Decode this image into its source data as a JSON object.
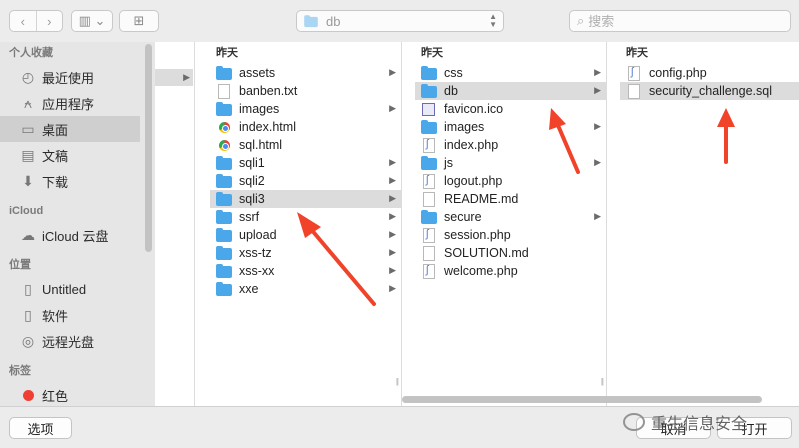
{
  "toolbar": {
    "back_glyph": "‹",
    "forward_glyph": "›",
    "view_glyph": "▥ ⌄",
    "new_folder_glyph": "⊞",
    "path_label": "db",
    "search_placeholder": "搜索"
  },
  "sidebar": {
    "sections": [
      {
        "header": "个人收藏",
        "items": [
          {
            "label": "最近使用",
            "icon": "clock-icon",
            "glyph": "◴"
          },
          {
            "label": "应用程序",
            "icon": "applications-icon",
            "glyph": "⍲"
          },
          {
            "label": "桌面",
            "icon": "desktop-icon",
            "glyph": "▭",
            "selected": true
          },
          {
            "label": "文稿",
            "icon": "documents-icon",
            "glyph": "▤"
          },
          {
            "label": "下载",
            "icon": "download-icon",
            "glyph": "⬇"
          }
        ]
      },
      {
        "header": "iCloud",
        "items": [
          {
            "label": "iCloud 云盘",
            "icon": "cloud-icon",
            "glyph": "☁"
          }
        ]
      },
      {
        "header": "位置",
        "items": [
          {
            "label": "Untitled",
            "icon": "disk-icon",
            "glyph": "▯"
          },
          {
            "label": "软件",
            "icon": "disk-icon",
            "glyph": "▯"
          },
          {
            "label": "远程光盘",
            "icon": "optical-disc-icon",
            "glyph": "◎"
          }
        ]
      },
      {
        "header": "标签",
        "items": [
          {
            "label": "红色",
            "icon": "red-tag-icon",
            "color": "#ef3f34"
          }
        ]
      }
    ]
  },
  "columns": [
    {
      "header": "昨天",
      "items": [
        {
          "name": "assets",
          "kind": "folder",
          "chevron": true
        },
        {
          "name": "banben.txt",
          "kind": "file"
        },
        {
          "name": "images",
          "kind": "folder",
          "chevron": true
        },
        {
          "name": "index.html",
          "kind": "chrome"
        },
        {
          "name": "sql.html",
          "kind": "chrome"
        },
        {
          "name": "sqli1",
          "kind": "folder",
          "chevron": true
        },
        {
          "name": "sqli2",
          "kind": "folder",
          "chevron": true
        },
        {
          "name": "sqli3",
          "kind": "folder",
          "chevron": true,
          "selected": true
        },
        {
          "name": "ssrf",
          "kind": "folder",
          "chevron": true
        },
        {
          "name": "upload",
          "kind": "folder",
          "chevron": true
        },
        {
          "name": "xss-tz",
          "kind": "folder",
          "chevron": true
        },
        {
          "name": "xss-xx",
          "kind": "folder",
          "chevron": true
        },
        {
          "name": "xxe",
          "kind": "folder",
          "chevron": true
        }
      ]
    },
    {
      "header": "昨天",
      "items": [
        {
          "name": "css",
          "kind": "folder",
          "chevron": true
        },
        {
          "name": "db",
          "kind": "folder",
          "chevron": true,
          "selected": true
        },
        {
          "name": "favicon.ico",
          "kind": "ico"
        },
        {
          "name": "images",
          "kind": "folder",
          "chevron": true
        },
        {
          "name": "index.php",
          "kind": "code"
        },
        {
          "name": "js",
          "kind": "folder",
          "chevron": true
        },
        {
          "name": "logout.php",
          "kind": "code"
        },
        {
          "name": "README.md",
          "kind": "file"
        },
        {
          "name": "secure",
          "kind": "folder",
          "chevron": true
        },
        {
          "name": "session.php",
          "kind": "code"
        },
        {
          "name": "SOLUTION.md",
          "kind": "file"
        },
        {
          "name": "welcome.php",
          "kind": "code"
        }
      ]
    },
    {
      "header": "昨天",
      "items": [
        {
          "name": "config.php",
          "kind": "code"
        },
        {
          "name": "security_challenge.sql",
          "kind": "file",
          "selected": true
        }
      ]
    }
  ],
  "bottom": {
    "options_label": "选项",
    "cancel_label": "取消",
    "open_label": "打开",
    "watermark_text": "重生信息安全"
  },
  "annotation_color": "#f0432a"
}
